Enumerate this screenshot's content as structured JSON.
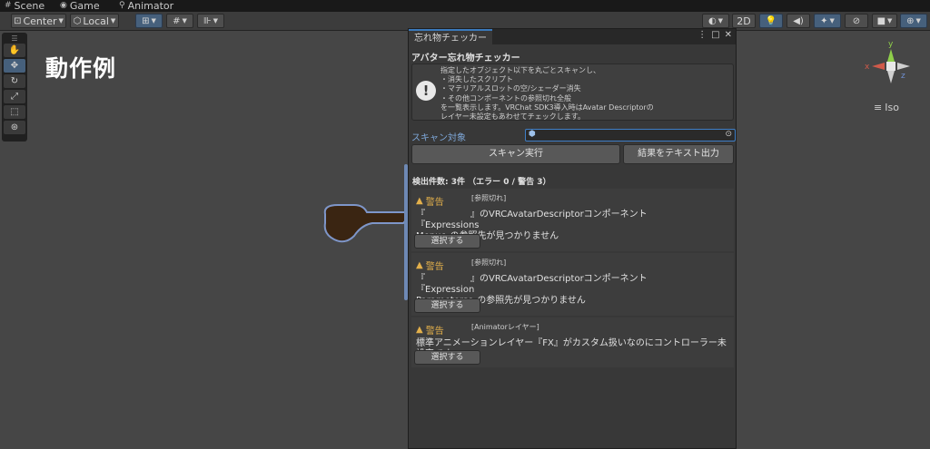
{
  "tabs": [
    {
      "label": "Scene",
      "icon": "hash-icon"
    },
    {
      "label": "Game",
      "icon": "gamepad-icon"
    },
    {
      "label": "Animator",
      "icon": "animator-icon"
    }
  ],
  "toolbar": {
    "pivot_label": "Center",
    "space_label": "Local",
    "mode_2d": "2D"
  },
  "scene": {
    "overlay_title": "動作例",
    "view_label": "Iso",
    "gizmo_axes": {
      "y": "y",
      "x": "x",
      "z": "z"
    }
  },
  "panel": {
    "tab_title": "忘れ物チェッカー",
    "heading": "アバター忘れ物チェッカー",
    "help_lines": [
      "指定したオブジェクト以下を丸ごとスキャンし、",
      "・消失したスクリプト",
      "・マテリアルスロットの空/シェーダー消失",
      "・その他コンポーネントの参照切れ全般",
      "を一覧表示します。VRChat SDK3導入時はAvatar Descriptorの",
      "レイヤー未設定もあわせてチェックします。"
    ],
    "scan_label": "スキャン対象",
    "scan_button": "スキャン実行",
    "export_button": "結果をテキスト出力",
    "count_text": "検出件数: 3件 （エラー 0 / 警告 3）",
    "results": [
      {
        "severity": "警告",
        "category": "[参照切れ]",
        "message_line1": "『　　　　　』のVRCAvatarDescriptorコンポーネント『Expressions",
        "message_line2": "Menu』の参照先が見つかりません",
        "select_label": "選択する"
      },
      {
        "severity": "警告",
        "category": "[参照切れ]",
        "message_line1": "『　　　　　』のVRCAvatarDescriptorコンポーネント『Expression",
        "message_line2": "Parameters』の参照先が見つかりません",
        "select_label": "選択する"
      },
      {
        "severity": "警告",
        "category": "[Animatorレイヤー]",
        "message_line1": "標準アニメーションレイヤー『FX』がカスタム扱いなのにコントローラー未設定です",
        "message_line2": "",
        "select_label": "選択する"
      }
    ]
  },
  "colors": {
    "accent": "#3a79bb",
    "warning": "#e3b04b",
    "link_label": "#7ea7d8"
  }
}
